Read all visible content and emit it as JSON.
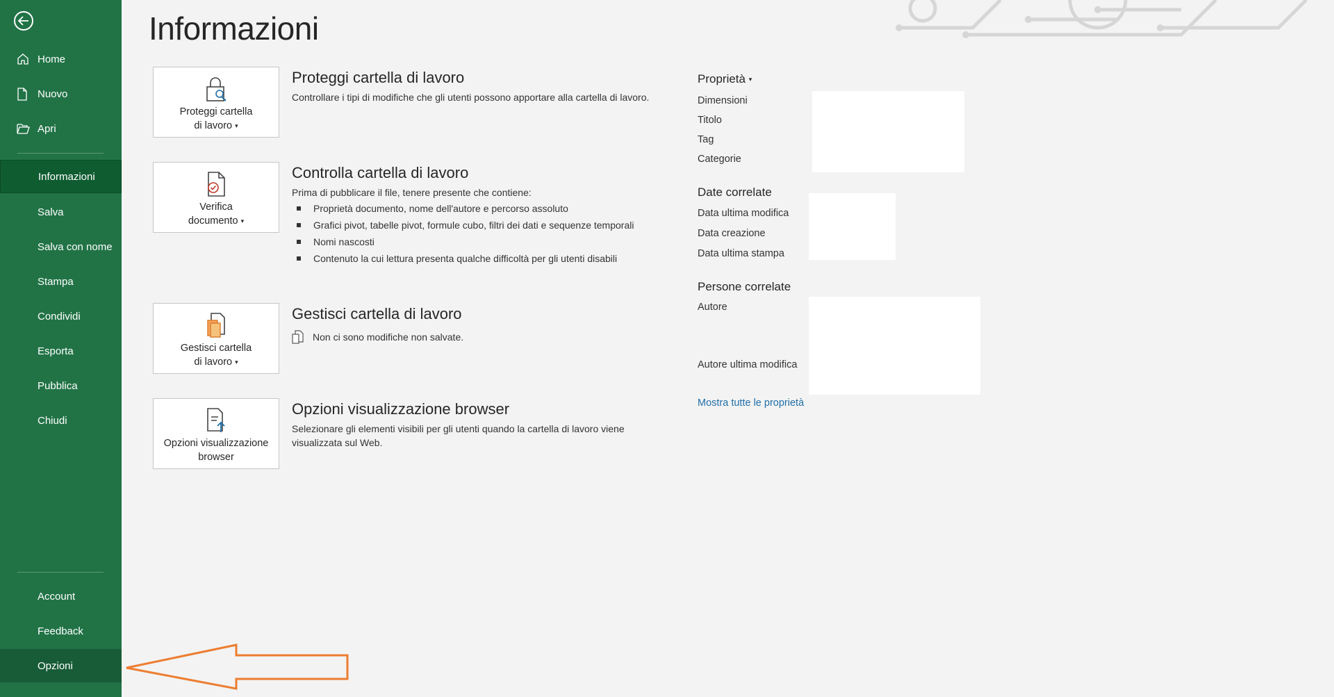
{
  "sidebar": {
    "items_top": [
      {
        "label": "Home",
        "icon": "home-icon"
      },
      {
        "label": "Nuovo",
        "icon": "new-file-icon"
      },
      {
        "label": "Apri",
        "icon": "open-folder-icon"
      }
    ],
    "items_mid": [
      {
        "label": "Informazioni",
        "selected": true
      },
      {
        "label": "Salva"
      },
      {
        "label": "Salva con nome"
      },
      {
        "label": "Stampa"
      },
      {
        "label": "Condividi"
      },
      {
        "label": "Esporta"
      },
      {
        "label": "Pubblica"
      },
      {
        "label": "Chiudi"
      }
    ],
    "items_bottom": [
      {
        "label": "Account"
      },
      {
        "label": "Feedback"
      },
      {
        "label": "Opzioni"
      }
    ]
  },
  "main": {
    "title": "Informazioni",
    "sections": [
      {
        "button_line1": "Proteggi cartella",
        "button_line2": "di lavoro",
        "title": "Proteggi cartella di lavoro",
        "description": "Controllare i tipi di modifiche che gli utenti possono apportare alla cartella di lavoro."
      },
      {
        "button_line1": "Verifica",
        "button_line2": "documento",
        "title": "Controlla cartella di lavoro",
        "description": "Prima di pubblicare il file, tenere presente che contiene:",
        "bullets": [
          "Proprietà documento, nome dell'autore e percorso assoluto",
          "Grafici pivot, tabelle pivot, formule cubo, filtri dei dati e sequenze temporali",
          "Nomi nascosti",
          "Contenuto la cui lettura presenta qualche difficoltà per gli utenti disabili"
        ]
      },
      {
        "button_line1": "Gestisci cartella",
        "button_line2": "di lavoro",
        "title": "Gestisci cartella di lavoro",
        "description": "Non ci sono modifiche non salvate."
      },
      {
        "button_line1": "Opzioni visualizzazione",
        "button_line2": "browser",
        "title": "Opzioni visualizzazione browser",
        "description": "Selezionare gli elementi visibili per gli utenti quando la cartella di lavoro viene visualizzata sul Web."
      }
    ]
  },
  "properties": {
    "header": "Proprietà",
    "rows": [
      "Dimensioni",
      "Titolo",
      "Tag",
      "Categorie"
    ],
    "dates_header": "Date correlate",
    "date_rows": [
      "Data ultima modifica",
      "Data creazione",
      "Data ultima stampa"
    ],
    "people_header": "Persone correlate",
    "people_rows": [
      "Autore",
      "Autore ultima modifica"
    ],
    "show_all_link": "Mostra tutte le proprietà"
  },
  "colors": {
    "sidebar_bg": "#217346",
    "sidebar_selected": "#0f5c31",
    "annotation_arrow": "#ed7d31",
    "link": "#1f6fa8"
  }
}
